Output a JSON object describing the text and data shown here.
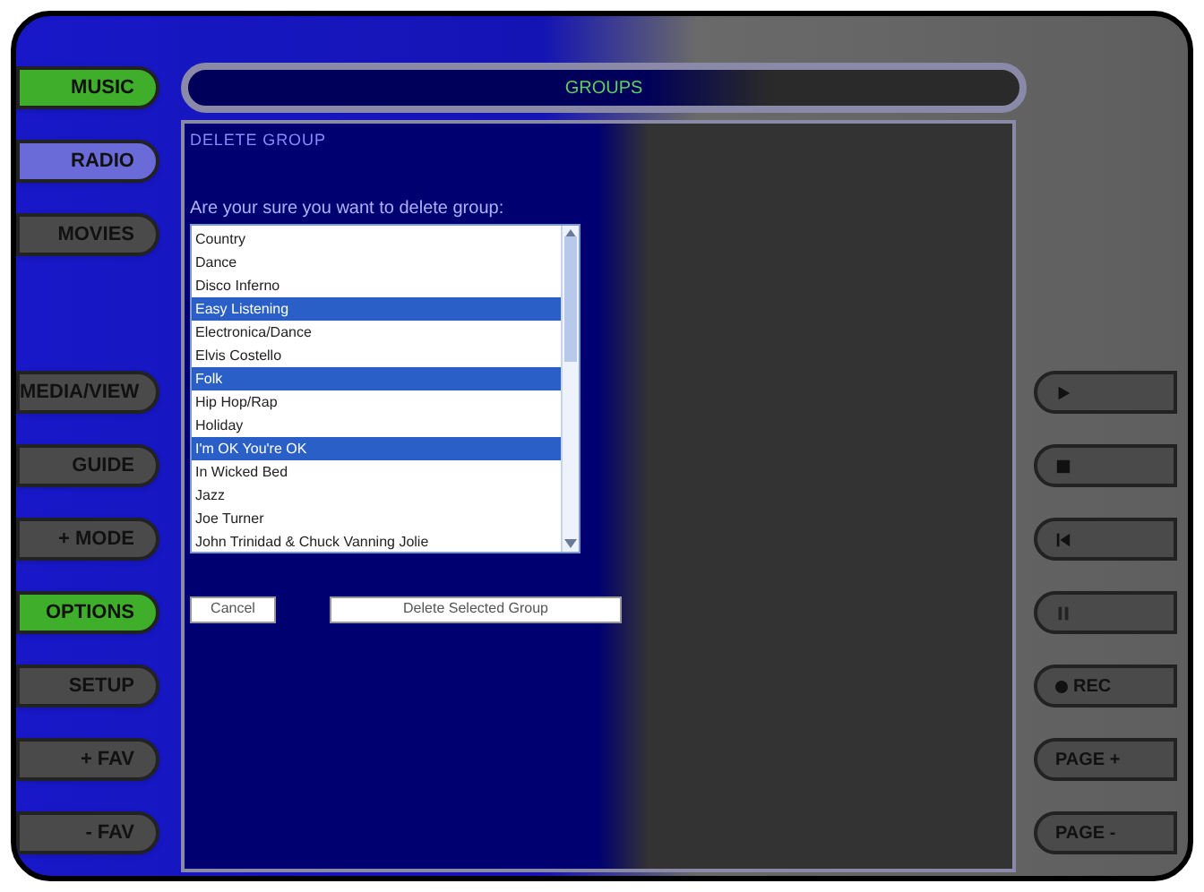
{
  "title": "GROUPS",
  "sidebar": {
    "sections": [
      [
        {
          "label": "MUSIC",
          "color": "#3fae2a"
        },
        {
          "label": "RADIO",
          "color": "#6a6ad8"
        },
        {
          "label": "MOVIES",
          "color": "#4a4a4a"
        }
      ],
      [
        {
          "label": "MEDIA/VIEW",
          "color": "#4a4a4a"
        },
        {
          "label": "GUIDE",
          "color": "#4a4a4a"
        },
        {
          "label": "+ MODE",
          "color": "#4a4a4a"
        },
        {
          "label": "OPTIONS",
          "color": "#3fae2a"
        },
        {
          "label": "SETUP",
          "color": "#4a4a4a"
        },
        {
          "label": "+ FAV",
          "color": "#4a4a4a"
        },
        {
          "label": "- FAV",
          "color": "#4a4a4a"
        }
      ]
    ]
  },
  "dialog": {
    "heading": "DELETE GROUP",
    "prompt": "Are your sure you want to delete group:",
    "groups": [
      {
        "label": "Country",
        "selected": false
      },
      {
        "label": "Dance",
        "selected": false
      },
      {
        "label": "Disco Inferno",
        "selected": false
      },
      {
        "label": "Easy Listening",
        "selected": true
      },
      {
        "label": "Electronica/Dance",
        "selected": false
      },
      {
        "label": "Elvis Costello",
        "selected": false
      },
      {
        "label": "Folk",
        "selected": true
      },
      {
        "label": "Hip Hop/Rap",
        "selected": false
      },
      {
        "label": "Holiday",
        "selected": false
      },
      {
        "label": "I'm OK You're OK",
        "selected": true
      },
      {
        "label": "In Wicked Bed",
        "selected": false
      },
      {
        "label": "Jazz",
        "selected": false
      },
      {
        "label": "Joe Turner",
        "selected": false
      },
      {
        "label": "John Trinidad & Chuck Vanning Jolie",
        "selected": false
      }
    ],
    "buttons": [
      "Cancel",
      "Delete Selected Group"
    ]
  },
  "transport": [
    {
      "kind": "play"
    },
    {
      "kind": "stop"
    },
    {
      "kind": "previous"
    },
    {
      "kind": "pause"
    },
    {
      "kind": "record",
      "label": "REC"
    },
    {
      "kind": "text",
      "label": "PAGE +"
    },
    {
      "kind": "text",
      "label": "PAGE -"
    }
  ]
}
